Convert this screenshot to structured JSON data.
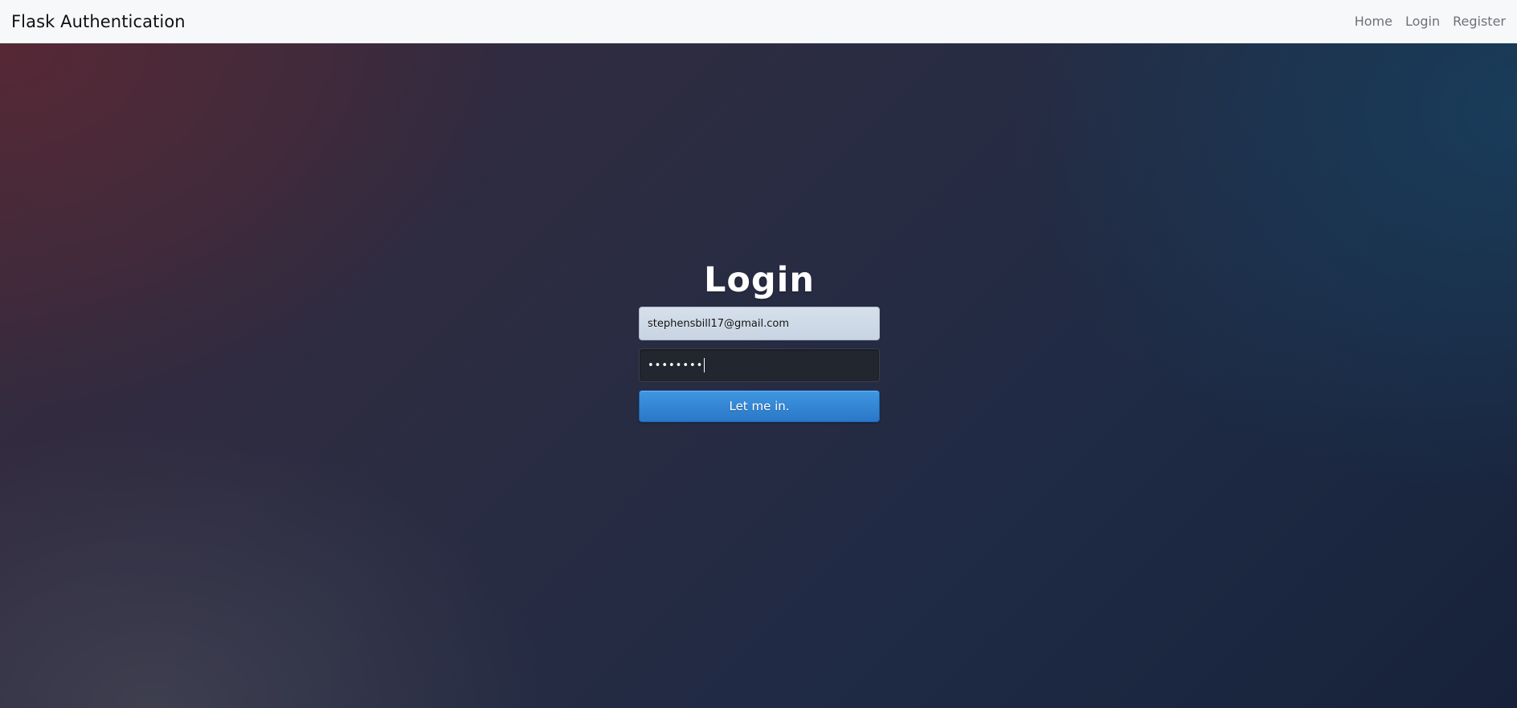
{
  "navbar": {
    "brand": "Flask Authentication",
    "links": [
      {
        "label": "Home"
      },
      {
        "label": "Login"
      },
      {
        "label": "Register"
      }
    ]
  },
  "login": {
    "title": "Login",
    "email_value": "stephensbill17@gmail.com",
    "password_masked": "••••••••",
    "submit_label": "Let me in."
  },
  "colors": {
    "navbar_bg": "#f7f8fa",
    "button_blue": "#2a78c8"
  }
}
